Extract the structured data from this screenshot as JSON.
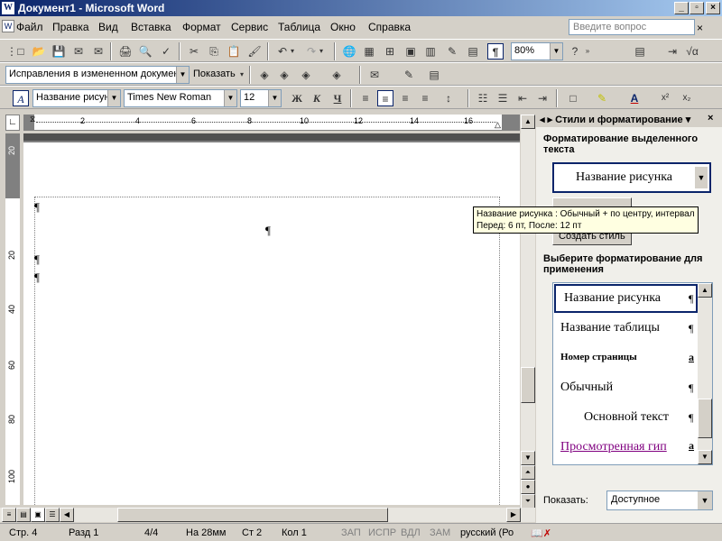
{
  "window": {
    "title": "Документ1 - Microsoft Word"
  },
  "menu": {
    "items": [
      "Файл",
      "Правка",
      "Вид",
      "Вставка",
      "Формат",
      "Сервис",
      "Таблица",
      "Окно",
      "Справка"
    ],
    "ask_placeholder": "Введите вопрос"
  },
  "toolbar1": {
    "zoom": "80%"
  },
  "toolbar2": {
    "review_mode": "Исправления в измененном докумен",
    "show_label": "Показать"
  },
  "formatting": {
    "style": "Название рисун",
    "font": "Times New Roman",
    "size": "12",
    "bold": "Ж",
    "italic": "К",
    "underline": "Ч",
    "superscript": "x²",
    "subscript": "x₂"
  },
  "ruler": {
    "h_ticks": [
      "2",
      "4",
      "6",
      "8",
      "10",
      "12",
      "14",
      "16"
    ],
    "v_ticks": [
      "20",
      "20",
      "40",
      "60",
      "80",
      "100"
    ]
  },
  "document": {
    "pilcrow": "¶"
  },
  "tooltip": {
    "line1": "Название рисунка : Обычный + по центру, интервал",
    "line2": "Перед:  6 пт, После:  12 пт"
  },
  "pane": {
    "title": "Стили и форматирование",
    "section1": "Форматирование выделенного текста",
    "current_style": "Название рисунка",
    "create_style": "Создать стиль",
    "section2": "Выберите форматирование для применения",
    "styles": [
      {
        "name": "Название рисунка",
        "mark": "¶"
      },
      {
        "name": "Название таблицы",
        "mark": "¶"
      },
      {
        "name": "Номер страницы",
        "mark": "a"
      },
      {
        "name": "Обычный",
        "mark": "¶"
      },
      {
        "name": "Основной текст",
        "mark": "¶"
      },
      {
        "name": "Просмотренная гип",
        "mark": "a"
      }
    ],
    "show_label": "Показать:",
    "show_value": "Доступное"
  },
  "status": {
    "page": "Стр. 4",
    "section": "Разд 1",
    "pages": "4/4",
    "at": "На 28мм",
    "line": "Ст 2",
    "col": "Кол 1",
    "rec": "ЗАП",
    "trk": "ИСПР",
    "ext": "ВДЛ",
    "ovr": "ЗАМ",
    "lang": "русский (Ро"
  }
}
